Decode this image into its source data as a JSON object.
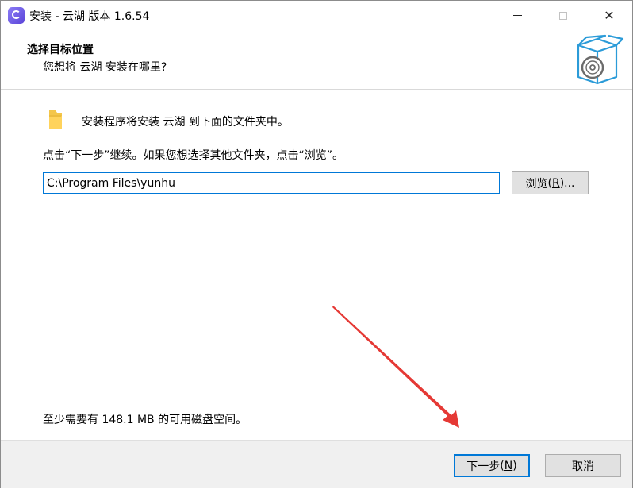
{
  "window": {
    "title": "安装 - 云湖 版本 1.6.54",
    "minimize_label": "–",
    "maximize_label": "□",
    "close_label": "✕"
  },
  "header": {
    "title": "选择目标位置",
    "subtitle": "您想将 云湖 安装在哪里?"
  },
  "body": {
    "intro": "安装程序将安装 云湖 到下面的文件夹中。",
    "instruction": "点击“下一步”继续。如果您想选择其他文件夹，点击“浏览”。",
    "install_path": "C:\\Program Files\\yunhu",
    "browse_label": "浏览",
    "browse_accel": "R",
    "space_note": "至少需要有 148.1 MB 的可用磁盘空间。"
  },
  "footer": {
    "next_label": "下一步",
    "next_accel": "N",
    "cancel_label": "取消"
  },
  "colors": {
    "accent": "#0078d7",
    "annotation_arrow": "#e53935",
    "footer_bg": "#f0f0f0"
  },
  "icons": [
    "app-icon",
    "folder-icon",
    "install-box-icon"
  ]
}
